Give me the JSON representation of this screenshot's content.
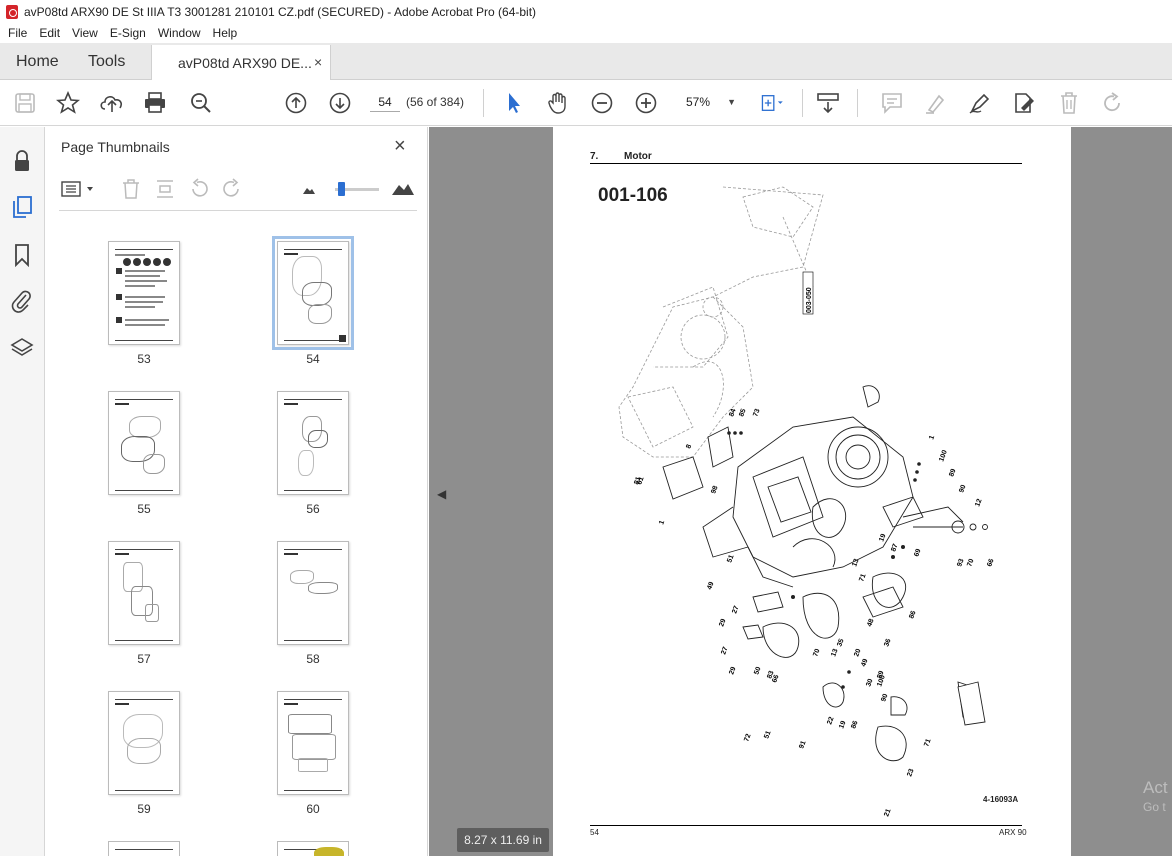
{
  "window": {
    "title": "avP08td ARX90 DE St IIIA T3 3001281 210101 CZ.pdf (SECURED) - Adobe Acrobat Pro (64-bit)"
  },
  "menu": [
    "File",
    "Edit",
    "View",
    "E-Sign",
    "Window",
    "Help"
  ],
  "tabs": {
    "home": "Home",
    "tools": "Tools",
    "document": "avP08td ARX90 DE...",
    "close": "×"
  },
  "toolbar": {
    "page_input": "54",
    "page_count": "(56 of 384)",
    "zoom": "57%"
  },
  "thumbnails_panel": {
    "title": "Page Thumbnails",
    "close": "×",
    "pages": [
      {
        "label": "53",
        "selected": false
      },
      {
        "label": "54",
        "selected": true
      },
      {
        "label": "55",
        "selected": false
      },
      {
        "label": "56",
        "selected": false
      },
      {
        "label": "57",
        "selected": false
      },
      {
        "label": "58",
        "selected": false
      },
      {
        "label": "59",
        "selected": false
      },
      {
        "label": "60",
        "selected": false
      }
    ]
  },
  "document_page": {
    "section_number": "7.",
    "section_title": "Motor",
    "part_number": "001-106",
    "callout_ref": "003-050",
    "figure_ref": "4-16093A",
    "footer_page": "54",
    "footer_model": "ARX 90",
    "callouts": [
      "84",
      "85",
      "73",
      "8",
      "98",
      "81",
      "1",
      "61",
      "1",
      "100",
      "89",
      "90",
      "12",
      "19",
      "87",
      "69",
      "93",
      "70",
      "66",
      "13",
      "71",
      "86",
      "51",
      "49",
      "48",
      "36",
      "27",
      "29",
      "27",
      "29",
      "50",
      "83",
      "66",
      "70",
      "13",
      "35",
      "20",
      "49",
      "30",
      "100",
      "89",
      "90",
      "22",
      "19",
      "86",
      "51",
      "72",
      "91",
      "71",
      "23",
      "21"
    ]
  },
  "status": {
    "page_size": "8.27 x 11.69 in"
  },
  "colors": {
    "accent": "#2b6ed1",
    "doc_background": "#8e8e8e",
    "tab_bar": "#e9e9e9"
  }
}
